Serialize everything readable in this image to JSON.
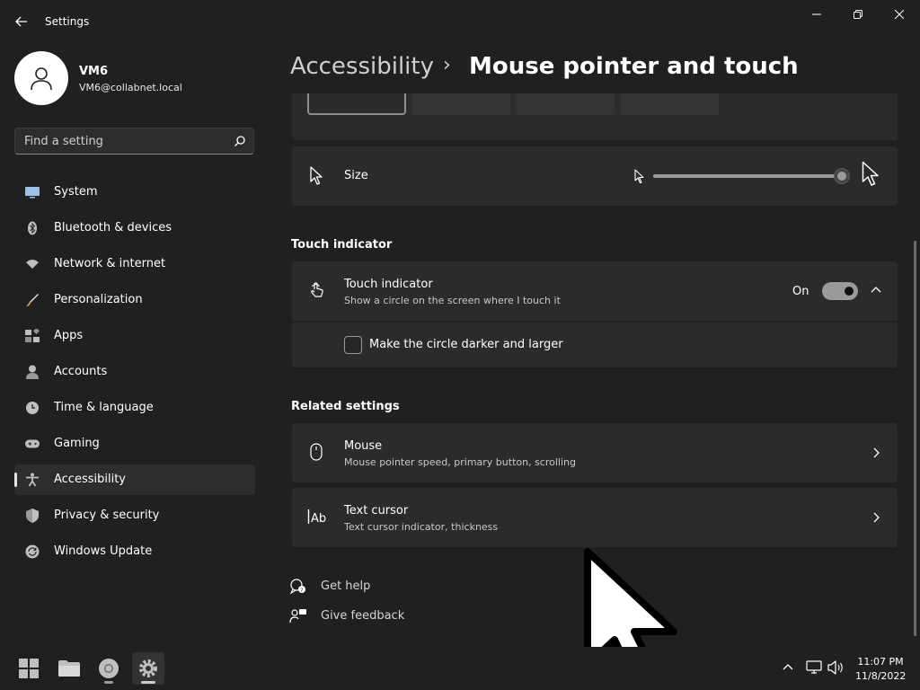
{
  "window": {
    "app_title": "Settings"
  },
  "profile": {
    "name": "VM6",
    "email": "VM6@collabnet.local"
  },
  "search": {
    "placeholder": "Find a setting"
  },
  "sidebar": {
    "items": [
      {
        "label": "System",
        "icon": "system-icon"
      },
      {
        "label": "Bluetooth & devices",
        "icon": "bluetooth-icon"
      },
      {
        "label": "Network & internet",
        "icon": "network-icon"
      },
      {
        "label": "Personalization",
        "icon": "brush-icon"
      },
      {
        "label": "Apps",
        "icon": "apps-icon"
      },
      {
        "label": "Accounts",
        "icon": "accounts-icon"
      },
      {
        "label": "Time & language",
        "icon": "clock-icon"
      },
      {
        "label": "Gaming",
        "icon": "gamepad-icon"
      },
      {
        "label": "Accessibility",
        "icon": "accessibility-icon",
        "selected": true
      },
      {
        "label": "Privacy & security",
        "icon": "shield-icon"
      },
      {
        "label": "Windows Update",
        "icon": "update-icon"
      }
    ]
  },
  "header": {
    "breadcrumb_parent": "Accessibility",
    "breadcrumb_separator": "›",
    "page_title": "Mouse pointer and touch"
  },
  "pointer_size": {
    "label": "Size",
    "value": 1.0
  },
  "touch_indicator": {
    "section_title": "Touch indicator",
    "title": "Touch indicator",
    "description": "Show a circle on the screen where I touch it",
    "state_label": "On",
    "enabled": true,
    "expanded": true,
    "option_label": "Make the circle darker and larger",
    "option_checked": false
  },
  "related_settings": {
    "section_title": "Related settings",
    "items": [
      {
        "title": "Mouse",
        "description": "Mouse pointer speed, primary button, scrolling",
        "icon": "mouse-icon"
      },
      {
        "title": "Text cursor",
        "description": "Text cursor indicator, thickness",
        "icon": "text-cursor-icon"
      }
    ]
  },
  "help_links": {
    "get_help": "Get help",
    "give_feedback": "Give feedback"
  },
  "taskbar": {
    "time": "11:07 PM",
    "date": "11/8/2022"
  },
  "colors": {
    "background": "#202020",
    "card": "#2b2b2b",
    "text": "#ffffff",
    "secondary_text": "#c8c8c8",
    "toggle_on": "#9a9a9a"
  }
}
